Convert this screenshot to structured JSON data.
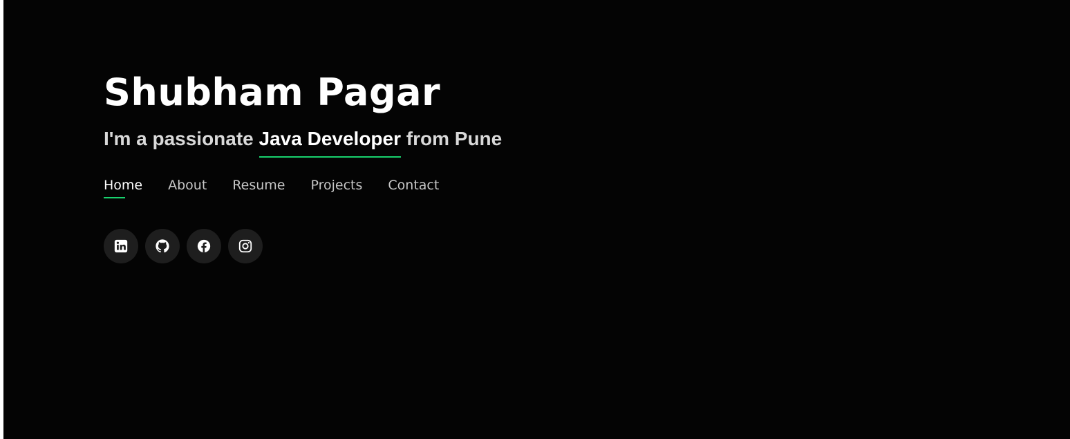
{
  "header": {
    "name": "Shubham Pagar",
    "tagline_prefix": "I'm a passionate ",
    "tagline_role": "Java Developer",
    "tagline_suffix": " from Pune"
  },
  "nav": {
    "items": [
      {
        "label": "Home",
        "active": true
      },
      {
        "label": "About",
        "active": false
      },
      {
        "label": "Resume",
        "active": false
      },
      {
        "label": "Projects",
        "active": false
      },
      {
        "label": "Contact",
        "active": false
      }
    ]
  },
  "social": {
    "icons": [
      "linkedin-icon",
      "github-icon",
      "facebook-icon",
      "instagram-icon"
    ]
  },
  "colors": {
    "background": "#040404",
    "accent": "#18d26e",
    "button_bg": "#1e1e1e",
    "text": "#ffffff",
    "muted_text": "#c7c7c7"
  }
}
